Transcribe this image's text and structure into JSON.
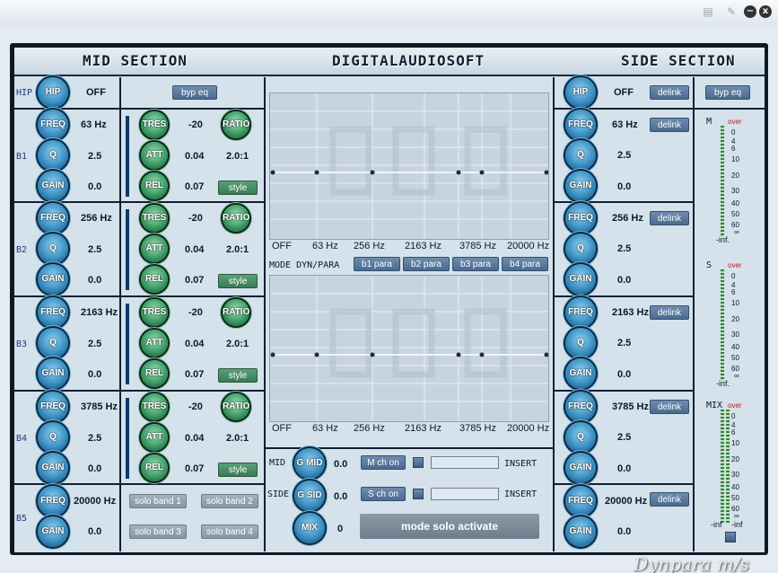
{
  "header": {
    "mid_title": "MID SECTION",
    "brand_title": "DIGITALAUDIOSOFT",
    "side_title": "SIDE SECTION"
  },
  "window": {
    "minimize": "−",
    "close": "x",
    "ico1": "▤",
    "ico2": "✎"
  },
  "mid": {
    "hip_label": "HIP",
    "hip_knob": "HIP",
    "hip_value": "OFF",
    "byp_eq": "byp eq",
    "bands": [
      {
        "label": "B1",
        "freq_knob": "FREQ",
        "freq": "63 Hz",
        "q_knob": "Q",
        "q": "2.5",
        "gain_knob": "GAIN",
        "gain": "0.0",
        "tres_knob": "TRES",
        "tres": "-20",
        "ratio_knob": "RATIO",
        "att_knob": "ATT",
        "att": "0.04",
        "ratio": "2.0:1",
        "rel_knob": "REL",
        "rel": "0.07",
        "style": "style"
      },
      {
        "label": "B2",
        "freq_knob": "FREQ",
        "freq": "256 Hz",
        "q_knob": "Q",
        "q": "2.5",
        "gain_knob": "GAIN",
        "gain": "0.0",
        "tres_knob": "TRES",
        "tres": "-20",
        "ratio_knob": "RATIO",
        "att_knob": "ATT",
        "att": "0.04",
        "ratio": "2.0:1",
        "rel_knob": "REL",
        "rel": "0.07",
        "style": "style"
      },
      {
        "label": "B3",
        "freq_knob": "FREQ",
        "freq": "2163 Hz",
        "q_knob": "Q",
        "q": "2.5",
        "gain_knob": "GAIN",
        "gain": "0.0",
        "tres_knob": "TRES",
        "tres": "-20",
        "ratio_knob": "RATIO",
        "att_knob": "ATT",
        "att": "0.04",
        "ratio": "2.0:1",
        "rel_knob": "REL",
        "rel": "0.07",
        "style": "style"
      },
      {
        "label": "B4",
        "freq_knob": "FREQ",
        "freq": "3785 Hz",
        "q_knob": "Q",
        "q": "2.5",
        "gain_knob": "GAIN",
        "gain": "0.0",
        "tres_knob": "TRES",
        "tres": "-20",
        "ratio_knob": "RATIO",
        "att_knob": "ATT",
        "att": "0.04",
        "ratio": "2.0:1",
        "rel_knob": "REL",
        "rel": "0.07",
        "style": "style"
      }
    ],
    "b5": {
      "label": "B5",
      "freq_knob": "FREQ",
      "freq": "20000 Hz",
      "gain_knob": "GAIN",
      "gain": "0.0"
    },
    "solo": [
      "solo band 1",
      "solo band 2",
      "solo band 3",
      "solo band 4"
    ]
  },
  "center": {
    "axis": [
      "OFF",
      "63 Hz",
      "256 Hz",
      "2163 Hz",
      "3785 Hz",
      "20000 Hz"
    ],
    "mode_label": "MODE DYN/PARA",
    "mode_buttons": [
      "b1 para",
      "b2 para",
      "b3 para",
      "b4 para"
    ],
    "mix": {
      "mid_label": "MID",
      "g_mid": "G MID",
      "mid_value": "0.0",
      "m_ch": "M ch on",
      "insert1": "INSERT",
      "side_label": "SIDE",
      "g_sid": "G SID",
      "side_value": "0.0",
      "s_ch": "S ch on",
      "insert2": "INSERT",
      "mix_knob": "MIX",
      "mix_value": "0",
      "solo_mode": "mode solo activate"
    }
  },
  "side": {
    "hip_knob": "HIP",
    "hip_value": "OFF",
    "delink": "delink",
    "byp_eq": "byp eq",
    "bands": [
      {
        "freq_knob": "FREQ",
        "freq": "63 Hz",
        "q_knob": "Q",
        "q": "2.5",
        "gain_knob": "GAIN",
        "gain": "0.0",
        "delink": "delink"
      },
      {
        "freq_knob": "FREQ",
        "freq": "256 Hz",
        "q_knob": "Q",
        "q": "2.5",
        "gain_knob": "GAIN",
        "gain": "0.0",
        "delink": "delink"
      },
      {
        "freq_knob": "FREQ",
        "freq": "2163 Hz",
        "q_knob": "Q",
        "q": "2.5",
        "gain_knob": "GAIN",
        "gain": "0.0",
        "delink": "delink"
      },
      {
        "freq_knob": "FREQ",
        "freq": "3785 Hz",
        "q_knob": "Q",
        "q": "2.5",
        "gain_knob": "GAIN",
        "gain": "0.0",
        "delink": "delink"
      }
    ],
    "b5": {
      "freq_knob": "FREQ",
      "freq": "20000 Hz",
      "gain_knob": "GAIN",
      "gain": "0.0",
      "delink": "delink"
    }
  },
  "meters": {
    "m_label": "M",
    "s_label": "S",
    "mix_label": "MIX",
    "over": "over",
    "ticks": [
      "0",
      "4",
      "6",
      "10",
      "20",
      "30",
      "40",
      "50",
      "60"
    ],
    "ticks_end": "∞",
    "inf": "-inf.",
    "mix_inf_l": "-inf",
    "mix_inf_r": "-inf"
  },
  "footer": {
    "brand": "Dynpara m/s"
  },
  "colors": {
    "frame": "#0d1a24",
    "panel": "#d5e1eb",
    "knob_blue": "#3a8fc2",
    "knob_green": "#3d9c68"
  }
}
